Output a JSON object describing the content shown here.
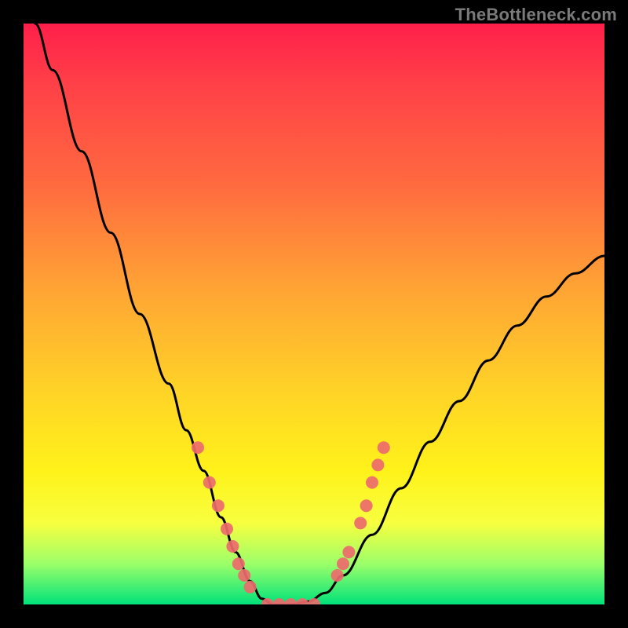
{
  "watermark": "TheBottleneck.com",
  "chart_data": {
    "type": "line",
    "title": "",
    "xlabel": "",
    "ylabel": "",
    "xlim": [
      0,
      100
    ],
    "ylim": [
      0,
      100
    ],
    "grid": false,
    "legend": false,
    "series": [
      {
        "name": "bottleneck-curve",
        "type": "line",
        "color": "#000000",
        "x": [
          2,
          5,
          10,
          15,
          20,
          25,
          28,
          31,
          34,
          36.5,
          39,
          41,
          43,
          46,
          49,
          52,
          55,
          60,
          65,
          70,
          75,
          80,
          85,
          90,
          95,
          100
        ],
        "y": [
          100,
          92,
          78,
          64,
          50,
          38,
          30,
          23,
          15,
          9,
          4,
          1,
          0,
          0,
          0.5,
          2,
          5,
          12,
          20,
          28,
          35,
          42,
          48,
          53,
          57,
          60
        ]
      },
      {
        "name": "curve-markers-left",
        "type": "scatter",
        "color": "#ed6a6d",
        "x": [
          30,
          32,
          33.5,
          35,
          36,
          37,
          38,
          39
        ],
        "y": [
          27,
          21,
          17,
          13,
          10,
          7,
          5,
          3
        ]
      },
      {
        "name": "curve-markers-right",
        "type": "scatter",
        "color": "#ed6a6d",
        "x": [
          54,
          55,
          56,
          58,
          59,
          60,
          61,
          62
        ],
        "y": [
          5,
          7,
          9,
          14,
          17,
          21,
          24,
          27
        ]
      },
      {
        "name": "curve-markers-bottom",
        "type": "scatter",
        "color": "#ed6a6d",
        "x": [
          42,
          44,
          46,
          48,
          50
        ],
        "y": [
          0,
          0,
          0,
          0,
          0
        ]
      }
    ]
  }
}
